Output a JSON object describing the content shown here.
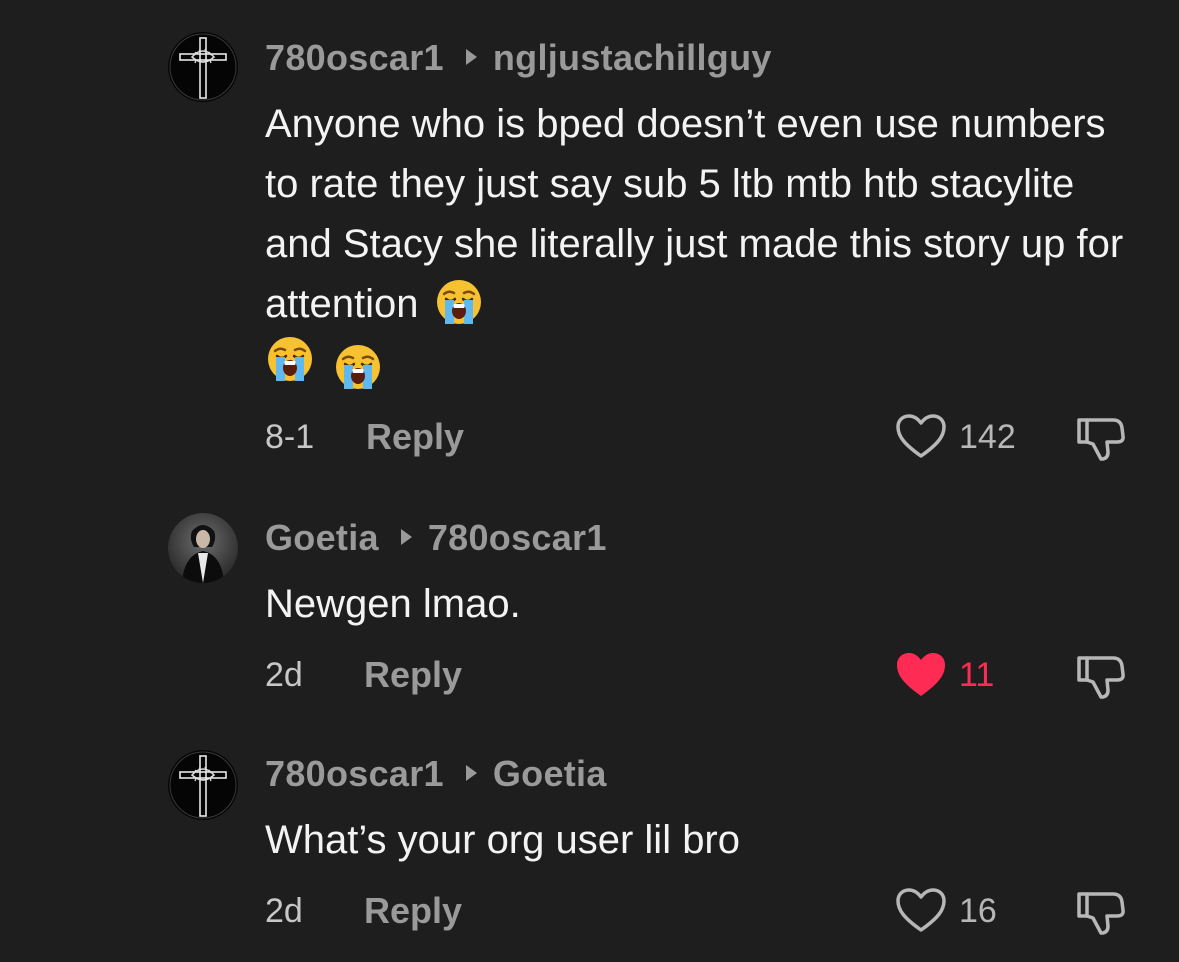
{
  "comments": [
    {
      "author": "780oscar1",
      "reply_to": "ngljustachillguy",
      "text": "Anyone who is bped doesn’t even use numbers to rate they just say sub 5 ltb mtb htb stacylite and Stacy she literally just made this story up for attention",
      "emoji": "loudly-crying-face",
      "time": "8-1",
      "reply_label": "Reply",
      "likes": "142",
      "liked": false
    },
    {
      "author": "Goetia",
      "reply_to": "780oscar1",
      "text": "Newgen lmao.",
      "time": "2d",
      "reply_label": "Reply",
      "likes": "11",
      "liked": true
    },
    {
      "author": "780oscar1",
      "reply_to": "Goetia",
      "text": "What’s your org user lil bro",
      "time": "2d",
      "reply_label": "Reply",
      "likes": "16",
      "liked": false
    }
  ],
  "colors": {
    "background": "#1e1e1e",
    "username": "#9a9a9a",
    "text": "#f3f3f3",
    "liked": "#fe2c55"
  }
}
